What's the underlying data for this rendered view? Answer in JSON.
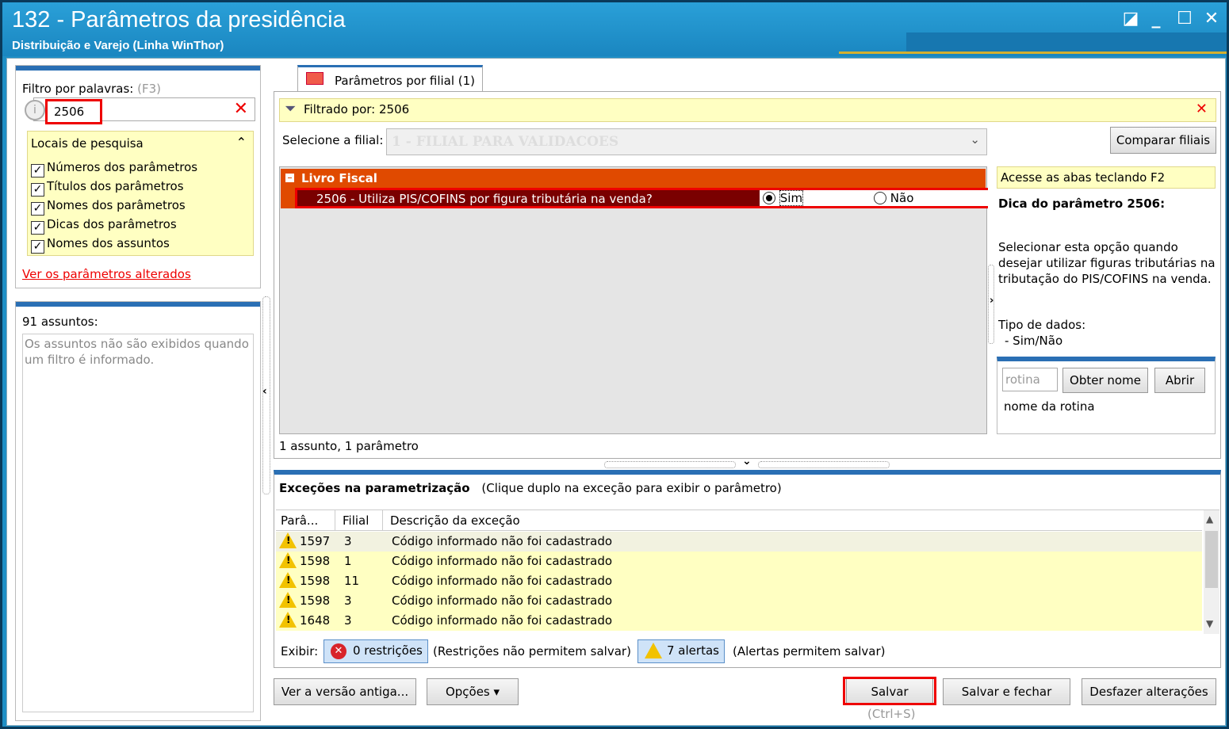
{
  "window": {
    "title": "132 - Parâmetros da presidência",
    "subtitle": "Distribuição e Varejo (Linha WinThor)"
  },
  "filter": {
    "label": "Filtro por palavras:",
    "hint": "(F3)",
    "value": "2506",
    "locais_label": "Locais de pesquisa",
    "options": [
      {
        "label": "Números dos parâmetros",
        "checked": true
      },
      {
        "label": "Títulos dos parâmetros",
        "checked": true
      },
      {
        "label": "Nomes dos parâmetros",
        "checked": true
      },
      {
        "label": "Dicas dos parâmetros",
        "checked": true
      },
      {
        "label": "Nomes dos assuntos",
        "checked": true
      }
    ],
    "link_alterados": "Ver os parâmetros alterados"
  },
  "assuntos": {
    "count_label": "91 assuntos:",
    "empty_text": "Os assuntos não são exibidos quando um filtro é informado."
  },
  "tab": {
    "label": "Parâmetros por filial  (1)"
  },
  "filtrado": {
    "text": "Filtrado por: 2506"
  },
  "filial": {
    "label": "Selecione a filial:",
    "value": "1 - FILIAL PARA VALIDACOES",
    "compare_button": "Comparar filiais"
  },
  "group": {
    "title": "Livro Fiscal",
    "param_desc": "2506 - Utiliza PIS/COFINS por figura tributária na venda?",
    "opt_sim": "Sim",
    "opt_nao": "Não",
    "selected": "Sim"
  },
  "status_line": "1 assunto, 1 parâmetro",
  "dica": {
    "acesse": "Acesse as abas teclando F2",
    "title": "Dica do parâmetro 2506:",
    "text": "Selecionar esta opção quando desejar utilizar figuras tributárias na tributação do PIS/COFINS na venda.",
    "tipo_label": "Tipo de dados:",
    "tipo_value": "- Sim/Não",
    "rotina_placeholder": "rotina",
    "obter_button": "Obter nome",
    "abrir_button": "Abrir",
    "rotina_nome": "nome da rotina"
  },
  "excecoes": {
    "title": "Exceções na parametrização",
    "hint": "(Clique duplo na exceção para exibir o parâmetro)",
    "columns": [
      "Parâ...",
      "Filial",
      "Descrição da exceção"
    ],
    "rows": [
      {
        "param": "1597",
        "filial": "3",
        "desc": "Código informado não foi cadastrado"
      },
      {
        "param": "1598",
        "filial": "1",
        "desc": "Código informado não foi cadastrado"
      },
      {
        "param": "1598",
        "filial": "11",
        "desc": "Código informado não foi cadastrado"
      },
      {
        "param": "1598",
        "filial": "3",
        "desc": "Código informado não foi cadastrado"
      },
      {
        "param": "1648",
        "filial": "3",
        "desc": "Código informado não foi cadastrado"
      }
    ],
    "exibir_label": "Exibir:",
    "restricoes": "0 restrições",
    "restricoes_note": "(Restrições não permitem salvar)",
    "alertas": "7 alertas",
    "alertas_note": "(Alertas permitem salvar)"
  },
  "footer": {
    "versao_antiga": "Ver a versão antiga...",
    "opcoes": "Opções ▾",
    "salvar": "Salvar",
    "salvar_hint": "(Ctrl+S)",
    "salvar_fechar": "Salvar e fechar",
    "desfazer": "Desfazer alterações"
  },
  "colors": {
    "titlebar": "#1f8fc6",
    "group_header": "#e04a00",
    "highlight": "#ee0000",
    "yellow_panel": "#ffffc2"
  }
}
